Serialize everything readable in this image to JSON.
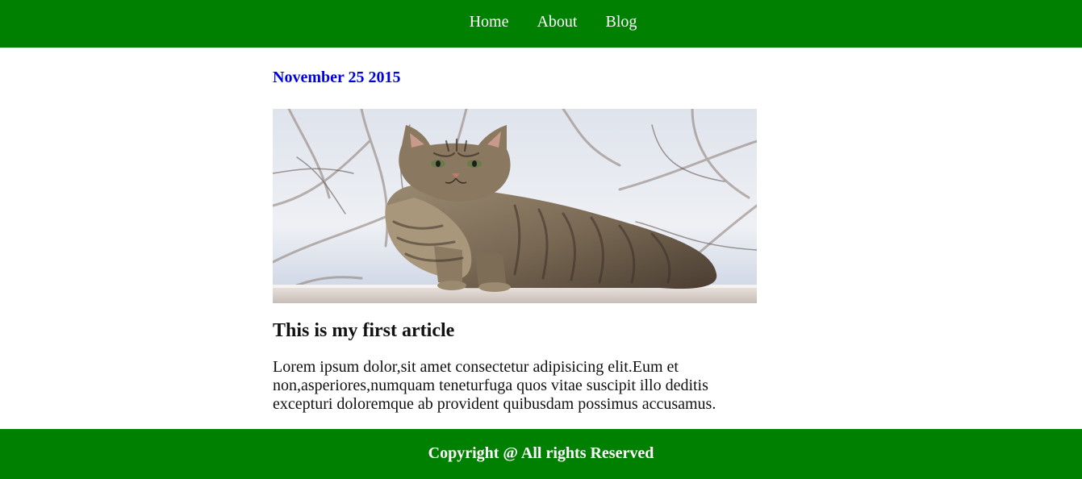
{
  "nav": {
    "items": [
      {
        "label": "Home"
      },
      {
        "label": "About"
      },
      {
        "label": "Blog"
      }
    ]
  },
  "article": {
    "date": "November 25 2015",
    "image_icon": "cat-photo",
    "title": "This is my first article",
    "body": "Lorem ipsum dolor,sit amet consectetur adipisicing elit.Eum et non,asperiores,numquam teneturfuga quos vitae suscipit illo deditis excepturi doloremque ab provident quibusdam possimus accusamus."
  },
  "footer": {
    "text": "Copyright @ All rights Reserved"
  },
  "colors": {
    "header_bg": "#008000",
    "footer_bg": "#008000",
    "date_color": "#0000e6",
    "link_color": "#ffffff"
  }
}
